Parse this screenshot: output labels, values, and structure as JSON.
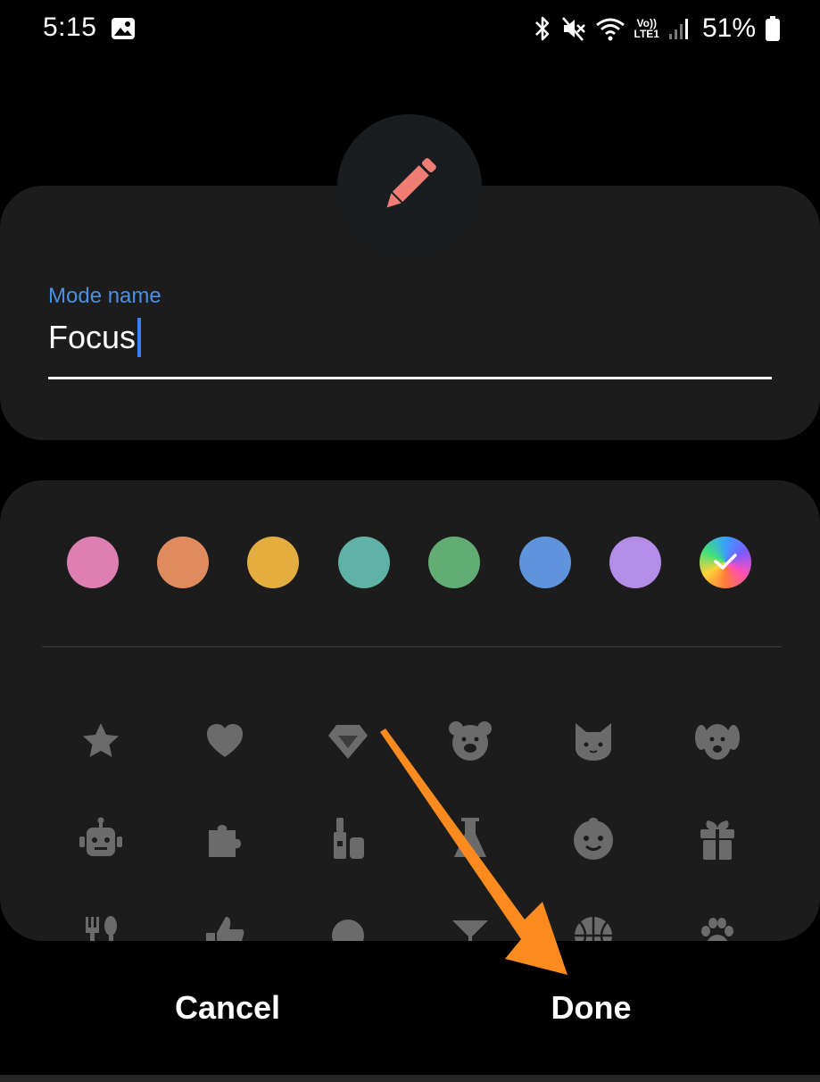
{
  "status_bar": {
    "time": "5:15",
    "battery_percent": "51%",
    "icons": [
      "gallery-icon",
      "bluetooth-icon",
      "mute-icon",
      "wifi-icon",
      "volte-icon",
      "signal-icon",
      "battery-icon"
    ],
    "volte_top": "Vo))",
    "volte_bottom": "LTE1"
  },
  "mode_icon": "pencil-icon",
  "mode_name": {
    "label": "Mode name",
    "value": "Focus"
  },
  "colors": [
    {
      "name": "pink",
      "hex": "#dd7fb0"
    },
    {
      "name": "orange",
      "hex": "#e08b5e"
    },
    {
      "name": "yellow",
      "hex": "#e3ae3f"
    },
    {
      "name": "teal",
      "hex": "#5fb2a6"
    },
    {
      "name": "green",
      "hex": "#62ad74"
    },
    {
      "name": "blue",
      "hex": "#5f94dc"
    },
    {
      "name": "purple",
      "hex": "#b58ce8"
    },
    {
      "name": "multicolor",
      "hex": "conic",
      "selected": true
    }
  ],
  "icon_grid": [
    [
      "star-icon",
      "heart-icon",
      "diamond-icon",
      "bear-icon",
      "cat-icon",
      "dog-icon"
    ],
    [
      "robot-icon",
      "puzzle-icon",
      "cosmetics-icon",
      "flask-icon",
      "baby-icon",
      "gift-icon"
    ],
    [
      "fork-spoon-icon",
      "thumbs-up-icon",
      "ball-icon",
      "cocktail-icon",
      "basketball-icon",
      "paw-icon"
    ]
  ],
  "accent_color": "#4b8fe2",
  "pencil_color": "#f07d74",
  "annotation_arrow_color": "#fb8a1f",
  "buttons": {
    "cancel": "Cancel",
    "done": "Done"
  }
}
